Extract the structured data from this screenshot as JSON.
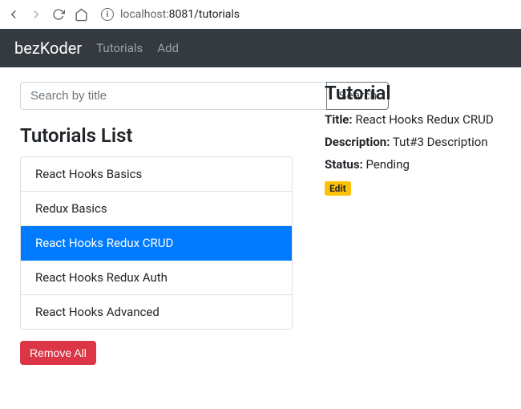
{
  "browser": {
    "url_host": "localhost:",
    "url_rest": "8081/tutorials"
  },
  "navbar": {
    "brand": "bezKoder",
    "links": [
      "Tutorials",
      "Add"
    ]
  },
  "search": {
    "placeholder": "Search by title",
    "button": "Search"
  },
  "list": {
    "heading": "Tutorials List",
    "items": [
      "React Hooks Basics",
      "Redux Basics",
      "React Hooks Redux CRUD",
      "React Hooks Redux Auth",
      "React Hooks Advanced"
    ],
    "active_index": 2,
    "remove_all": "Remove All"
  },
  "detail": {
    "heading": "Tutorial",
    "title_label": "Title:",
    "title_value": "React Hooks Redux CRUD",
    "description_label": "Description:",
    "description_value": "Tut#3 Description",
    "status_label": "Status:",
    "status_value": "Pending",
    "edit": "Edit"
  }
}
